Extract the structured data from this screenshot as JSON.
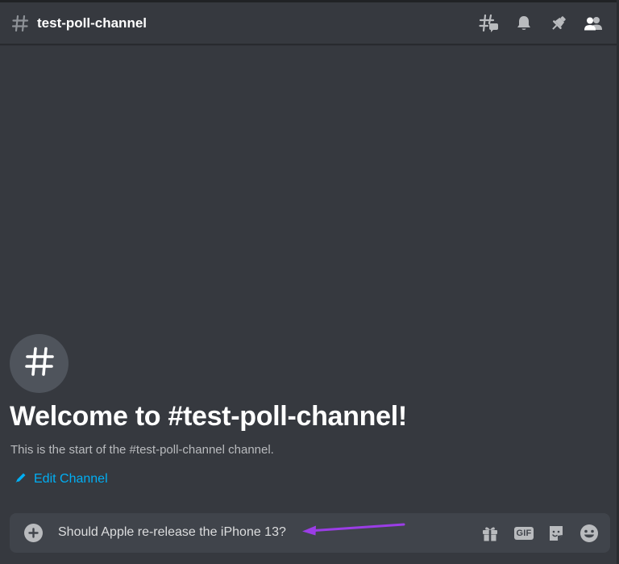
{
  "header": {
    "channel_name": "test-poll-channel",
    "icons": [
      "threads-icon",
      "bell-icon",
      "pin-icon",
      "members-icon"
    ]
  },
  "welcome": {
    "title": "Welcome to #test-poll-channel!",
    "subtitle": "This is the start of the #test-poll-channel channel.",
    "edit_channel": "Edit Channel",
    "avatar_icon": "hashtag-icon"
  },
  "composer": {
    "value": "Should Apple re-release the iPhone 13?",
    "gif_label": "GIF",
    "icons": [
      "plus-icon",
      "gift-icon",
      "gif-icon",
      "sticker-icon",
      "emoji-icon"
    ]
  },
  "annotation": {
    "arrow_color": "#9b3de6"
  },
  "colors": {
    "background": "#36393f",
    "composer": "#40444b",
    "link": "#00aff4",
    "icon": "#b9bbbe"
  }
}
